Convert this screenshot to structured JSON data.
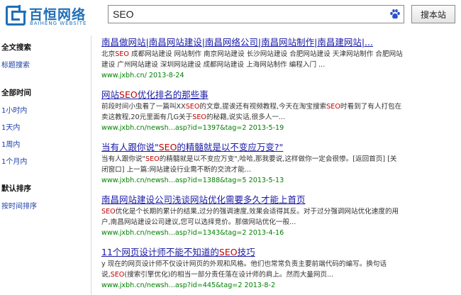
{
  "logo": {
    "name": "百恒网络",
    "subtitle": "BAIHENG WEBSITE"
  },
  "search": {
    "query": "SEO",
    "button_label": "搜本站"
  },
  "sidebar": {
    "sections": [
      {
        "heading": "全文搜索",
        "links": [
          "标题搜索"
        ]
      },
      {
        "heading": "全部时间",
        "links": [
          "1小时内",
          "1天内",
          "1周内",
          "1个月内"
        ]
      },
      {
        "heading": "默认排序",
        "links": [
          "按时间排序"
        ]
      }
    ]
  },
  "results": [
    {
      "title": "南昌做网站|南昌网站建设|南昌网络公司|南昌网站制作|南昌建网站|...",
      "snippet": "北京SEO 成都网站建设  网站制作  南京网站建设  长沙网站建设  合肥网站建设  天津网站制作  合肥网站建设  广州网站建设  深圳网站建设  成都网站建设  上海网站制作  编程入门  ...",
      "url": "www.jxbh.cn/",
      "date": "2013-8-24"
    },
    {
      "title": "网站SEO优化排名的那些事",
      "snippet": "前段时间小虫看了一篇叫XXSEO的文章,提诶还有视频教程,今天在淘宝搜索SEO时看到了有人打包在卖这教程,20元里面有几G关于SEO的秘籍,说实话,很多人一...",
      "url": "www.jxbh.cn/newsh...asp?id=1397&tag=2",
      "date": "2013-5-19"
    },
    {
      "title": "当有人跟你说\"SEO的精髓就是以不变应万变?\"",
      "snippet": "当有人跟你说\"SEO的精髓就是以不变应万变\",哈哈,那我要说,这样做你一定会很惨。[返回首页] [关闭窗口] 上一篇:网站建设行业需不断的交流才能...",
      "url": "www.jxbh.cn/newsh...asp?id=1388&tag=5",
      "date": "2013-5-13"
    },
    {
      "title": "南昌网站建设公司浅谈网站优化需要多久才能上首页",
      "snippet": "SEO优化是个长期的累计的结果,过分的强调速度,效果会适得其反。对于过分强调网站优化速度的用户,南昌网站建设公司建议,您可以选择竞价。那做网站优化一般...",
      "url": "www.jxbh.cn/newsh...asp?id=1343&tag=2",
      "date": "2013-4-16"
    },
    {
      "title": "11个网页设计师不能不知道的SEO技巧",
      "snippet": "y 现在的网页设计师不仅设计网页的外观和风格。他们也常常负责主要前端代码的编写。换句话说,SEO(搜索引擎优化)的相当一部分责任落在设计师的肩上。然而大量网页...",
      "url": "www.jxbh.cn/newsh...asp?id=445&tag=2",
      "date": "2013-8-2"
    }
  ],
  "colors": {
    "brand": "#1f6fb8",
    "link": "#1a1aa6",
    "highlight": "#c00000",
    "url_green": "#008000"
  }
}
